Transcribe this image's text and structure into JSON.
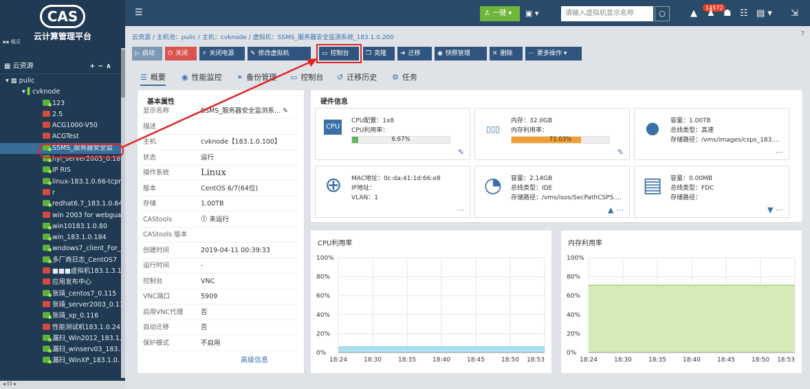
{
  "brand": {
    "logo": "CAS",
    "subtitle": "云计算管理平台",
    "small": "▪▪ 概况"
  },
  "sidebar": {
    "header": "云资源",
    "controls": "+ − ∧",
    "pool": "pulic",
    "host": "cvknode",
    "vms": [
      {
        "label": "123",
        "status": "run"
      },
      {
        "label": "2.5",
        "status": "stop"
      },
      {
        "label": "ACG1000-V50",
        "status": "stop"
      },
      {
        "label": "ACGTest",
        "status": "stop"
      },
      {
        "label": "SSMS_服务器安全监",
        "status": "run",
        "selected": true
      },
      {
        "label": "hyl_server2003_0.186",
        "status": "run"
      },
      {
        "label": "IP RIS",
        "status": "run"
      },
      {
        "label": "linux-183.1.0.66-tcpre",
        "status": "run"
      },
      {
        "label": "r",
        "status": "stop"
      },
      {
        "label": "redhat6.7_183.1.0.64",
        "status": "run"
      },
      {
        "label": "win 2003 for webguard",
        "status": "stop"
      },
      {
        "label": "win10183.1.0.80",
        "status": "run"
      },
      {
        "label": "win_183.1.0.184",
        "status": "run"
      },
      {
        "label": "wndows7_client_For_",
        "status": "run"
      },
      {
        "label": "多厂商日志_CentOS7",
        "status": "run"
      },
      {
        "label": "■■■虚拟机183.1.3.12",
        "status": "stop"
      },
      {
        "label": "应用发布中心",
        "status": "stop"
      },
      {
        "label": "张靖_centos7_0.115",
        "status": "run"
      },
      {
        "label": "张靖_server2003_0.11",
        "status": "stop"
      },
      {
        "label": "张靖_xp_0.116",
        "status": "run"
      },
      {
        "label": "性能测试机183.1.0.24",
        "status": "stop"
      },
      {
        "label": "漏扫_Win2012_183.1.",
        "status": "run"
      },
      {
        "label": "漏扫_winserv03_183.1",
        "status": "run"
      },
      {
        "label": "漏扫_WinXP_183.1.0.",
        "status": "run"
      }
    ],
    "hscroll": "◂   III   ▸"
  },
  "topbar": {
    "menu_icon": "☰",
    "onekey": "一键 ▾",
    "dropdown": "▣ ▾",
    "search_placeholder": "请输入虚拟机显示名称",
    "search_icon": "○",
    "badge": "14572",
    "icons": [
      "▲",
      "♟",
      "☗",
      "☷",
      "▤ ▾",
      "⇲"
    ]
  },
  "breadcrumb": "云资源 / 主机池：pulic / 主机：cvknode / 虚拟机：SSMS_服务器安全监测系统_183.1.0.200",
  "help_icon": "?",
  "toolbar": [
    {
      "icon": "▷",
      "label": "启动",
      "bg": "#7f98b4"
    },
    {
      "icon": "⏻",
      "label": "关闭",
      "bg": "#d9534f"
    },
    {
      "icon": "⚡",
      "label": "关闭电源",
      "bg": "#2f557f"
    },
    {
      "icon": "✎",
      "label": "修改虚拟机",
      "bg": "#2f557f"
    },
    {
      "icon": "▭",
      "label": "控制台",
      "bg": "#2f557f"
    },
    {
      "icon": "❐",
      "label": "克隆",
      "bg": "#2f557f"
    },
    {
      "icon": "➜",
      "label": "迁移",
      "bg": "#2f557f"
    },
    {
      "icon": "◉",
      "label": "快照管理",
      "bg": "#2f557f"
    },
    {
      "icon": "✕",
      "label": "删除",
      "bg": "#2f557f"
    },
    {
      "icon": "⋯",
      "label": "更多操作 ▾",
      "bg": "#2f557f"
    }
  ],
  "tabs": [
    {
      "icon": "☰",
      "label": "概要"
    },
    {
      "icon": "◉",
      "label": "性能监控"
    },
    {
      "icon": "⚭",
      "label": "备份管理"
    },
    {
      "icon": "▭",
      "label": "控制台"
    },
    {
      "icon": "↺",
      "label": "迁移历史"
    },
    {
      "icon": "⚙",
      "label": "任务"
    }
  ],
  "basic": {
    "title": "基本属性",
    "rows": [
      {
        "k": "显示名称",
        "v": "SSMS_服务器安全监测系... ✎"
      },
      {
        "k": "描述",
        "v": ""
      },
      {
        "k": "主机",
        "v": "cvknode【183.1.0.100】"
      },
      {
        "k": "状态",
        "v": "运行"
      },
      {
        "k": "操作系统",
        "v": "Linux"
      },
      {
        "k": "版本",
        "v": "CentOS 6/7(64位)"
      },
      {
        "k": "存储",
        "v": "1.00TB"
      },
      {
        "k": "CAStools",
        "v": "⓵ 未运行"
      },
      {
        "k": "CAStools 版本",
        "v": ""
      },
      {
        "k": "创建时间",
        "v": "2019-04-11 00:39:33"
      },
      {
        "k": "运行时间",
        "v": "-"
      },
      {
        "k": "控制台",
        "v": "VNC"
      },
      {
        "k": "VNC端口",
        "v": "5909"
      },
      {
        "k": "启用VNC代理",
        "v": "否"
      },
      {
        "k": "自动迁移",
        "v": "否"
      },
      {
        "k": "保护模式",
        "v": "不启用"
      }
    ],
    "advanced": "高级信息"
  },
  "hardware": {
    "title": "硬件信息",
    "cpu": {
      "icon": "CPU",
      "config": "CPU配置：1x8",
      "usage_label": "CPU利用率：",
      "usage": "6.67%",
      "usage_value": 0.0667,
      "color": "#5cb85c"
    },
    "mem": {
      "icon": "▯▯▯",
      "size": "内存：32.0GB",
      "usage_label": "内存利用率：",
      "usage": "71.03%",
      "usage_value": 0.7103,
      "color": "#f0a030"
    },
    "disk": {
      "icon": "●",
      "capacity": "容量：1.00TB",
      "bus": "总线类型：高速",
      "path": "存储路径：/vms/images/csps_183....",
      "more": "⋯"
    },
    "net": {
      "icon": "⊕",
      "mac": "MAC地址：0c:da:41:1d:66:e8",
      "ip": "IP地址：",
      "vlan": "VLAN：1",
      "more": "⋯"
    },
    "cd": {
      "icon": "◔",
      "capacity": "容量：2.14GB",
      "bus": "总线类型：IDE",
      "path": "存储路径：/vms/isos/SecPathCSPS....",
      "more": "▲ ⋯"
    },
    "floppy": {
      "icon": "▤",
      "capacity": "容量：0.00MB",
      "bus": "总线类型：FDC",
      "path": "存储路径：",
      "more": "▼ ⋯"
    }
  },
  "chart_data": [
    {
      "type": "area",
      "title": "CPU利用率",
      "x": [
        "18:24",
        "18:30",
        "18:35",
        "18:40",
        "18:45",
        "18:50",
        "18:53"
      ],
      "yticks": [
        "0%",
        "20%",
        "40%",
        "60%",
        "80%",
        "100%"
      ],
      "ylim": [
        0,
        100
      ],
      "series": [
        {
          "values": [
            6,
            6,
            6,
            6,
            6,
            6,
            6
          ]
        }
      ],
      "color": "#aee0f4",
      "line": "#5bc0de"
    },
    {
      "type": "area",
      "title": "内存利用率",
      "x": [
        "18:24",
        "18:30",
        "18:35",
        "18:40",
        "18:45",
        "18:50",
        "18:53"
      ],
      "yticks": [
        "0%",
        "20%",
        "40%",
        "60%",
        "80%",
        "100%"
      ],
      "ylim": [
        0,
        100
      ],
      "series": [
        {
          "values": [
            71,
            71,
            71,
            71,
            71,
            71,
            71
          ]
        }
      ],
      "color": "#d5eab8",
      "line": "#8cc04a"
    }
  ]
}
